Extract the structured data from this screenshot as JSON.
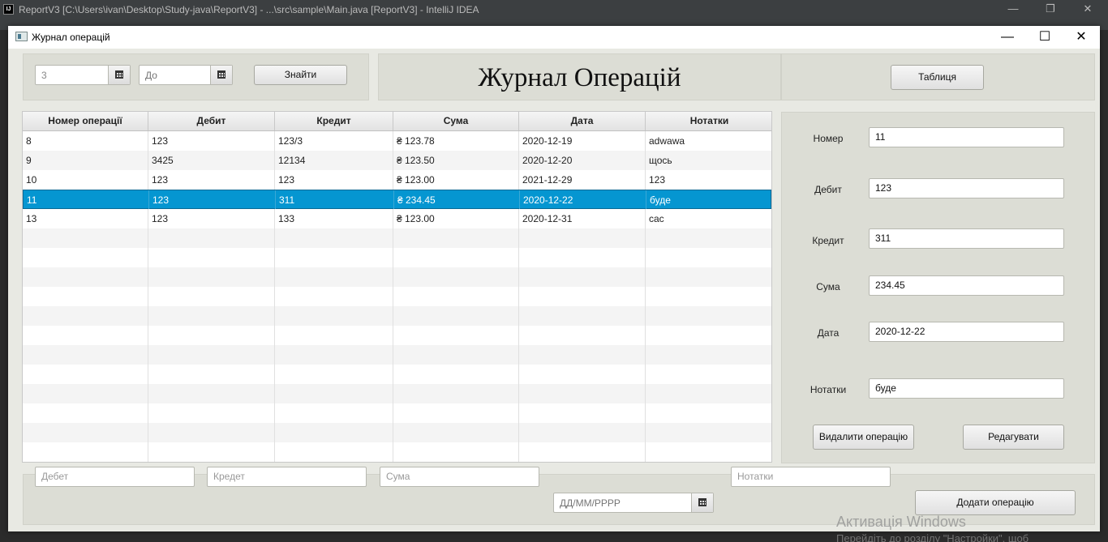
{
  "ide": {
    "title": "ReportV3 [C:\\Users\\ivan\\Desktop\\Study-java\\ReportV3] - ...\\src\\sample\\Main.java [ReportV3] - IntelliJ IDEA",
    "icon_text": "IJ"
  },
  "window": {
    "title": "Журнал операцій",
    "minimize": "—",
    "maximize": "☐",
    "close": "✕"
  },
  "search": {
    "from_value": "3",
    "to_placeholder": "До",
    "find_label": "Знайти"
  },
  "header": {
    "title": "Журнал Операцій",
    "table_button": "Таблиця"
  },
  "table": {
    "columns": [
      "Номер операції",
      "Дебит",
      "Кредит",
      "Сума",
      "Дата",
      "Нотатки"
    ],
    "rows": [
      [
        "8",
        "123",
        "123/3",
        "₴ 123.78",
        "2020-12-19",
        "adwawa"
      ],
      [
        "9",
        "3425",
        "12134",
        "₴ 123.50",
        "2020-12-20",
        "щось"
      ],
      [
        "10",
        "123",
        "123",
        "₴ 123.00",
        "2021-12-29",
        "123"
      ],
      [
        "11",
        "123",
        "311",
        "₴ 234.45",
        "2020-12-22",
        "буде"
      ],
      [
        "13",
        "123",
        "133",
        "₴ 123.00",
        "2020-12-31",
        "сас"
      ]
    ],
    "selected_row": 3
  },
  "details": {
    "number_label": "Номер",
    "number_value": "11",
    "debit_label": "Дебит",
    "debit_value": "123",
    "credit_label": "Кредит",
    "credit_value": "311",
    "sum_label": "Сума",
    "sum_value": "234.45",
    "date_label": "Дата",
    "date_value": "2020-12-22",
    "notes_label": "Нотатки",
    "notes_value": "буде",
    "delete_button": "Видалити операцію",
    "edit_button": "Редагувати"
  },
  "add_form": {
    "debit_placeholder": "Дебет",
    "credit_placeholder": "Кредет",
    "sum_placeholder": "Сума",
    "date_placeholder": "ДД/ММ/РРРР",
    "notes_placeholder": "Нотатки",
    "add_button": "Додати операцію"
  },
  "watermark": {
    "line1": "Активація Windows",
    "line2": "Перейдіть до розділу \"Настройки\", щоб"
  }
}
